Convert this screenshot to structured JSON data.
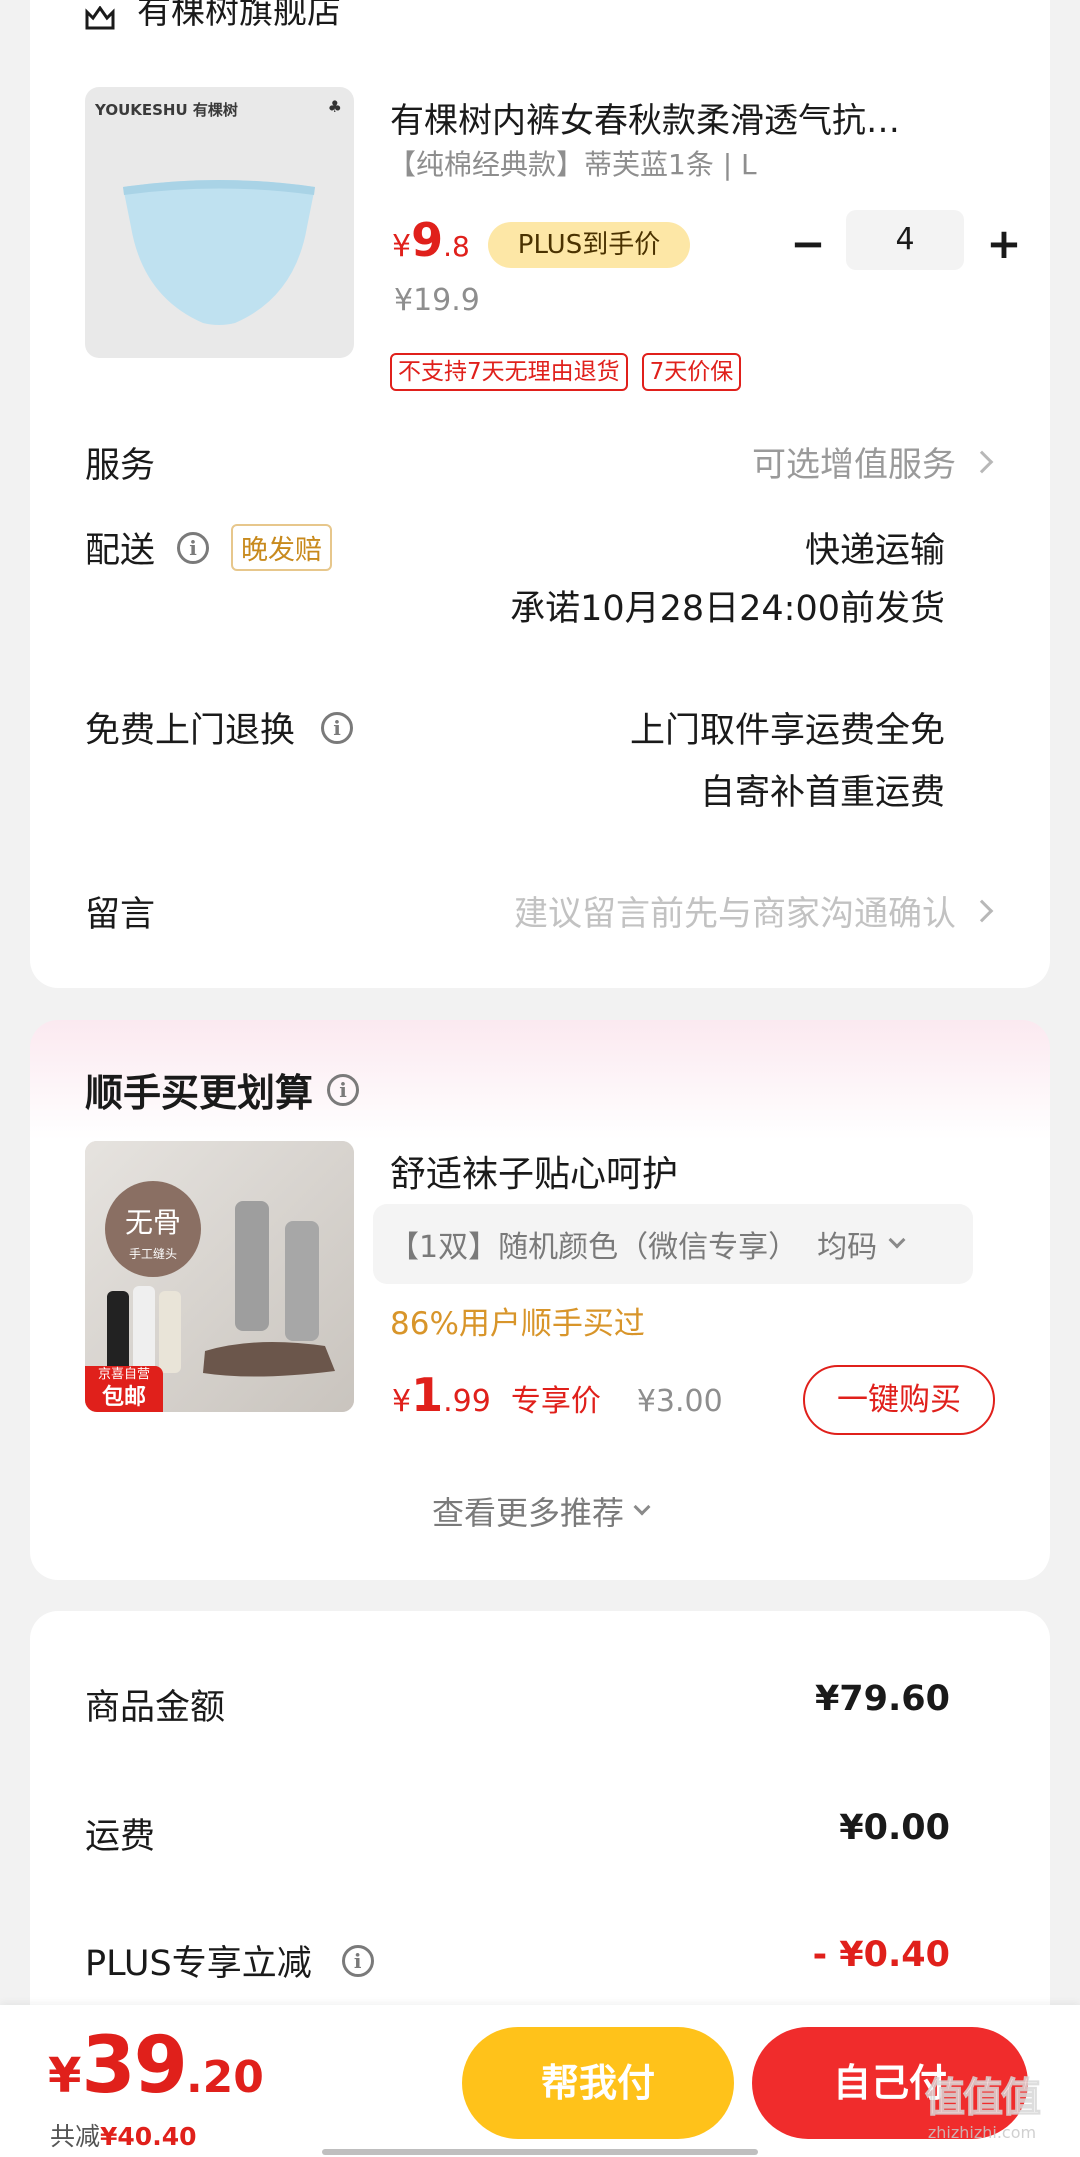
{
  "store": {
    "name": "有棵树旗舰店"
  },
  "product": {
    "brand_image_text": "YOUKESHU 有棵树",
    "title": "有棵树内裤女春秋款柔滑透气抗…",
    "spec": "【纯棉经典款】蒂芙蓝1条 | L",
    "price_symbol": "¥",
    "price_int": "9",
    "price_dec": ".8",
    "plus_badge": "PLUS到手价",
    "original_price": "¥19.9",
    "quantity": "4",
    "minus_label": "−",
    "plus_label": "+",
    "tags": [
      "不支持7天无理由退货",
      "7天价保"
    ]
  },
  "service": {
    "label": "服务",
    "value": "可选增值服务"
  },
  "delivery": {
    "label": "配送",
    "badge": "晚发赔",
    "method": "快递运输",
    "promise": "承诺10月28日24:00前发货"
  },
  "free_return": {
    "label": "免费上门退换",
    "line1": "上门取件享运费全免",
    "line2": "自寄补首重运费"
  },
  "message": {
    "label": "留言",
    "placeholder": "建议留言前先与商家沟通确认"
  },
  "addon": {
    "section_title": "顺手买更划算",
    "image_text_main": "无骨",
    "image_text_sub": "手工缝头",
    "image_badge_top": "京喜自营",
    "image_badge_bottom": "包邮",
    "title": "舒适袜子贴心呵护",
    "spec": "【1双】随机颜色（微信专享）  均码",
    "bought_text": "86%用户顺手买过",
    "price_symbol": "¥",
    "price_int": "1",
    "price_dec": ".99",
    "price_tag": "专享价",
    "original_price": "¥3.00",
    "buy_button": "一键购买",
    "more_link": "查看更多推荐"
  },
  "summary": {
    "rows": [
      {
        "label": "商品金额",
        "value": "¥79.60"
      },
      {
        "label": "运费",
        "value": "¥0.00"
      },
      {
        "label": "PLUS专享立减",
        "value": "- ¥0.40"
      }
    ]
  },
  "footer": {
    "total_symbol": "¥",
    "total_int": "39",
    "total_dec": ".20",
    "discount_label": "共减",
    "discount_value": "¥40.40",
    "help_pay_button": "帮我付",
    "self_pay_button": "自己付",
    "watermark_main": "值值值",
    "watermark_sub": "zhizhizhi.com"
  },
  "colors": {
    "accent_red": "#e0201b",
    "help_pay_yellow": "#ffc21a",
    "self_pay_red": "#f02c2c",
    "addon_gradient_top": "#fbe9f0",
    "product_image_bg": "#e9e9e9",
    "product_garment": "#bfe1f0"
  }
}
